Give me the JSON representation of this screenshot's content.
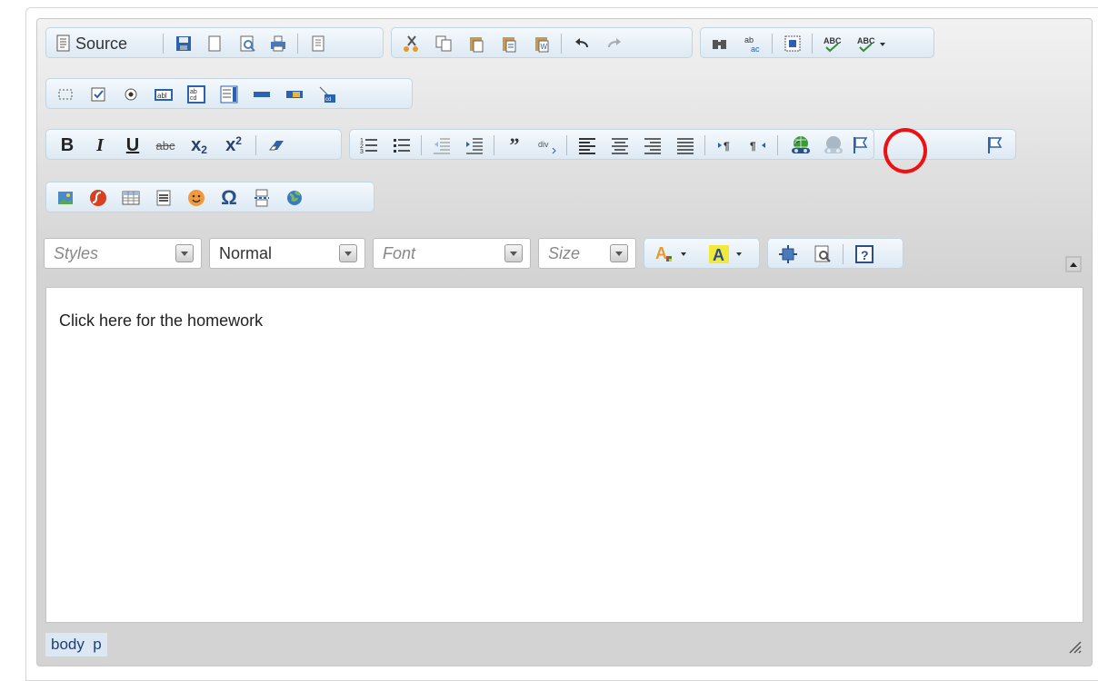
{
  "toolbar": {
    "source_label": "Source",
    "styles_placeholder": "Styles",
    "format_value": "Normal",
    "font_placeholder": "Font",
    "size_placeholder": "Size"
  },
  "content": {
    "text": "Click here for the homework"
  },
  "path_bar": {
    "text": "body  p"
  },
  "colors": {
    "group_bg": "#dde9f3",
    "highlight": "#ee1111"
  }
}
